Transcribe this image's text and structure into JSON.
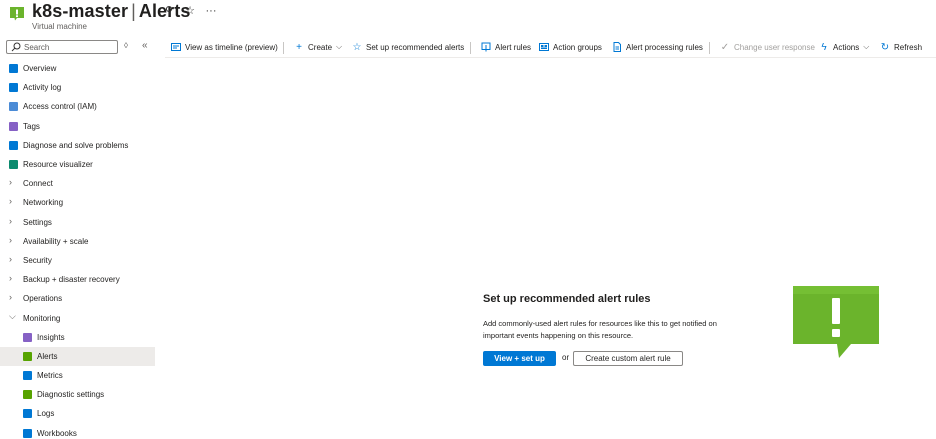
{
  "header": {
    "resource_name": "k8s-master",
    "separator": "|",
    "page_name": "Alerts",
    "subtitle": "Virtual machine",
    "pin_glyph": "⚲",
    "star_glyph": "☆",
    "more_glyph": "···"
  },
  "sidebar": {
    "search_placeholder": "Search",
    "options_glyph": "◊",
    "collapse_glyph": "«",
    "items": [
      {
        "label": "Overview",
        "icon": "overview-icon",
        "color": "#0078d4",
        "type": "icon"
      },
      {
        "label": "Activity log",
        "icon": "activity-log-icon",
        "color": "#0078d4",
        "type": "icon"
      },
      {
        "label": "Access control (IAM)",
        "icon": "iam-icon",
        "color": "#4b8bd6",
        "type": "icon"
      },
      {
        "label": "Tags",
        "icon": "tag-icon",
        "color": "#8661c5",
        "type": "icon"
      },
      {
        "label": "Diagnose and solve problems",
        "icon": "diagnose-icon",
        "color": "#0078d4",
        "type": "icon"
      },
      {
        "label": "Resource visualizer",
        "icon": "visualizer-icon",
        "color": "#0b8a6e",
        "type": "icon"
      },
      {
        "label": "Connect",
        "type": "group"
      },
      {
        "label": "Networking",
        "type": "group"
      },
      {
        "label": "Settings",
        "type": "group"
      },
      {
        "label": "Availability + scale",
        "type": "group"
      },
      {
        "label": "Security",
        "type": "group"
      },
      {
        "label": "Backup + disaster recovery",
        "type": "group"
      },
      {
        "label": "Operations",
        "type": "group"
      },
      {
        "label": "Monitoring",
        "type": "group-open"
      },
      {
        "label": "Insights",
        "icon": "insights-icon",
        "color": "#8661c5",
        "type": "child"
      },
      {
        "label": "Alerts",
        "icon": "alerts-icon",
        "color": "#57a300",
        "type": "child",
        "active": true
      },
      {
        "label": "Metrics",
        "icon": "metrics-icon",
        "color": "#0078d4",
        "type": "child"
      },
      {
        "label": "Diagnostic settings",
        "icon": "diagnostic-settings-icon",
        "color": "#57a300",
        "type": "child"
      },
      {
        "label": "Logs",
        "icon": "logs-icon",
        "color": "#0078d4",
        "type": "child"
      },
      {
        "label": "Workbooks",
        "icon": "workbooks-icon",
        "color": "#0078d4",
        "type": "child"
      }
    ]
  },
  "toolbar": {
    "view_timeline": "View as timeline (preview)",
    "create": "Create",
    "setup_recommended": "Set up recommended alerts",
    "alert_rules": "Alert rules",
    "action_groups": "Action groups",
    "alert_processing_rules": "Alert processing rules",
    "change_user_response": "Change user response",
    "actions": "Actions",
    "refresh": "Refresh"
  },
  "empty_state": {
    "title": "Set up recommended alert rules",
    "description": "Add commonly-used alert rules for resources like this to get notified on important events happening on this resource.",
    "primary_button": "View + set up",
    "or_text": "or",
    "secondary_button": "Create custom alert rule"
  },
  "colors": {
    "accent": "#0078d4",
    "alert_green": "#6bb42c",
    "alert_green_dark": "#57a300"
  }
}
